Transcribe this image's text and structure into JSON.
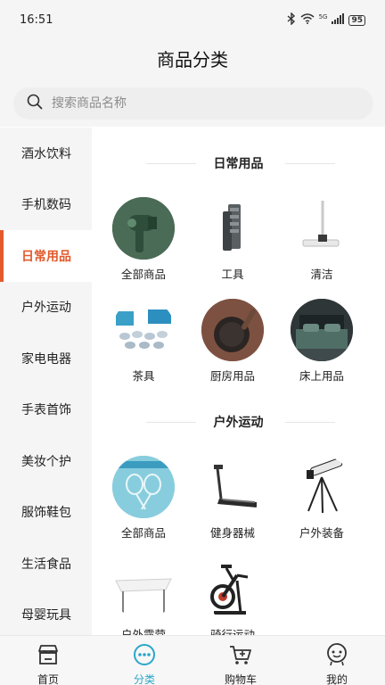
{
  "status": {
    "time": "16:51",
    "battery": "95",
    "network": "5G"
  },
  "header": {
    "title": "商品分类"
  },
  "search": {
    "placeholder": "搜索商品名称"
  },
  "sidebar": {
    "items": [
      {
        "label": "酒水饮料"
      },
      {
        "label": "手机数码"
      },
      {
        "label": "日常用品"
      },
      {
        "label": "户外运动"
      },
      {
        "label": "家电电器"
      },
      {
        "label": "手表首饰"
      },
      {
        "label": "美妆个护"
      },
      {
        "label": "服饰鞋包"
      },
      {
        "label": "生活食品"
      },
      {
        "label": "母婴玩具"
      }
    ],
    "active_index": 2
  },
  "sections": [
    {
      "title": "日常用品",
      "items": [
        {
          "label": "全部商品",
          "icon": "hair-dryer-image"
        },
        {
          "label": "工具",
          "icon": "tool-kit-image"
        },
        {
          "label": "清洁",
          "icon": "mop-image"
        },
        {
          "label": "茶具",
          "icon": "tea-set-image"
        },
        {
          "label": "厨房用品",
          "icon": "wok-image"
        },
        {
          "label": "床上用品",
          "icon": "bed-image"
        }
      ]
    },
    {
      "title": "户外运动",
      "items": [
        {
          "label": "全部商品",
          "icon": "badminton-image"
        },
        {
          "label": "健身器械",
          "icon": "treadmill-image"
        },
        {
          "label": "户外装备",
          "icon": "telescope-image"
        },
        {
          "label": "户外露营",
          "icon": "canopy-image"
        },
        {
          "label": "骑行运动",
          "icon": "spin-bike-image"
        }
      ]
    }
  ],
  "tabbar": {
    "items": [
      {
        "label": "首页",
        "icon": "store-icon"
      },
      {
        "label": "分类",
        "icon": "category-dots-icon"
      },
      {
        "label": "购物车",
        "icon": "cart-icon"
      },
      {
        "label": "我的",
        "icon": "profile-icon"
      }
    ],
    "active_index": 1
  },
  "colors": {
    "accent": "#e2592c",
    "tab_active": "#2aa7c9",
    "background": "#f5f5f5"
  }
}
